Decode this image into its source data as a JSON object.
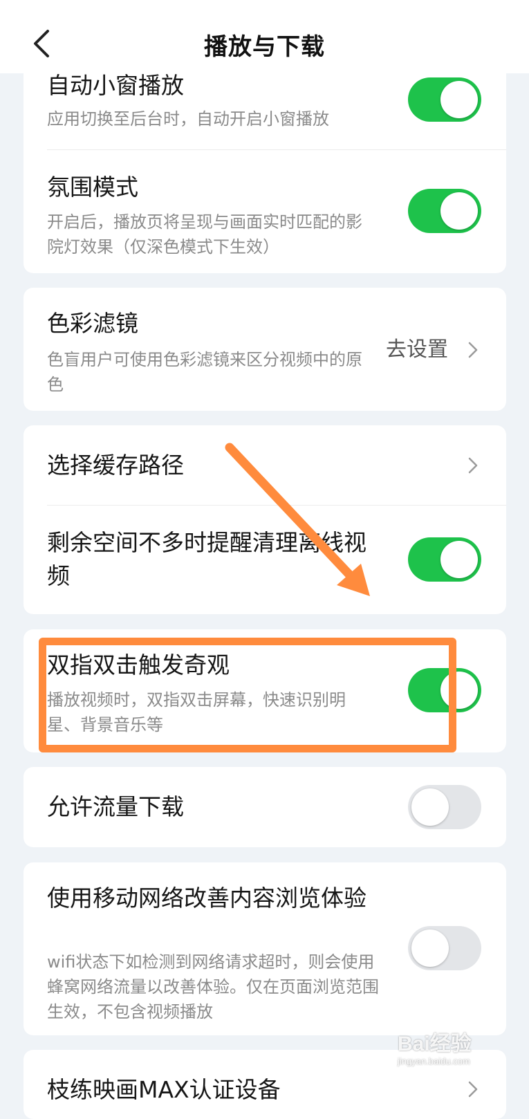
{
  "header": {
    "title": "播放与下载"
  },
  "section1": {
    "items": [
      {
        "title": "自动小窗播放",
        "desc": "应用切换至后台时，自动开启小窗播放",
        "enabled": true
      },
      {
        "title": "氛围模式",
        "desc": "开启后，播放页将呈现与画面实时匹配的影院灯效果（仅深色模式下生效）",
        "enabled": true
      }
    ]
  },
  "section2": {
    "title": "色彩滤镜",
    "desc": "色盲用户可使用色彩滤镜来区分视频中的原色",
    "action": "去设置"
  },
  "section3": {
    "items": [
      {
        "title": "选择缓存路径"
      },
      {
        "title": "剩余空间不多时提醒清理离线视频",
        "enabled": true
      }
    ]
  },
  "section4": {
    "title": "双指双击触发奇观",
    "desc": "播放视频时，双指双击屏幕，快速识别明星、背景音乐等",
    "enabled": true
  },
  "section5": {
    "title": "允许流量下载",
    "enabled": false
  },
  "section6": {
    "title": "使用移动网络改善内容浏览体验",
    "desc": "wifi状态下如检测到网络请求超时，则会使用蜂窝网络流量以改善体验。仅在页面浏览范围生效，不包含视频播放",
    "enabled": false
  },
  "section7": {
    "title": "枝练映画MAX认证设备"
  },
  "watermark": {
    "brand": "Bai经验",
    "url": "jingyan.baidu.com"
  },
  "colors": {
    "toggle_on": "#1ec24b",
    "toggle_off": "#e3e5e8",
    "annotation": "#ff8b3d",
    "background": "#eff3f7"
  }
}
